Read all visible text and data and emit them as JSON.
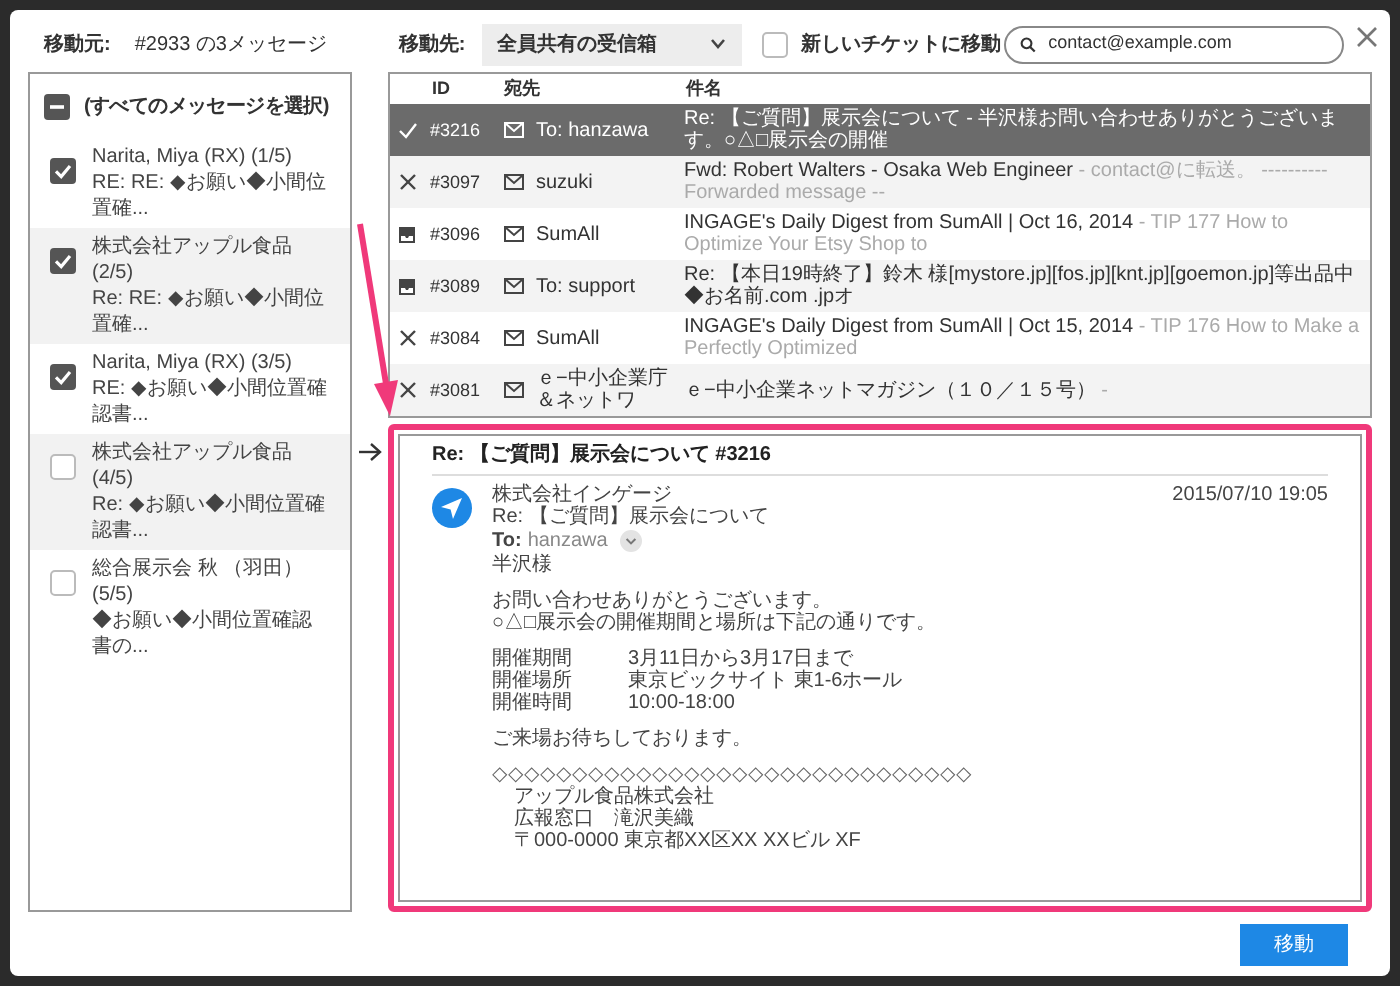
{
  "header": {
    "source_label": "移動元:",
    "source_value": "#2933 の3メッセージ",
    "destination_label": "移動先:",
    "destination_value": "全員共有の受信箱",
    "new_ticket": {
      "label": "新しいチケットに移動",
      "checked": false
    },
    "search": {
      "value": "contact@example.com"
    }
  },
  "messages": {
    "select_all": {
      "label": "(すべてのメッセージを選択)",
      "indeterminate": true
    },
    "items": [
      {
        "sender": "Narita, Miya (RX)  (1/5)",
        "subject": "RE: RE: ◆お願い◆小間位置確...",
        "checked": true
      },
      {
        "sender": "株式会社アップル食品  (2/5)",
        "subject": "Re: RE: ◆お願い◆小間位置確...",
        "checked": true
      },
      {
        "sender": "Narita, Miya (RX)  (3/5)",
        "subject": "RE: ◆お願い◆小間位置確認書...",
        "checked": true
      },
      {
        "sender": "株式会社アップル食品  (4/5)",
        "subject": "Re: ◆お願い◆小間位置確認書...",
        "checked": false
      },
      {
        "sender": "総合展示会 秋 （羽田）  (5/5)",
        "subject": "◆お願い◆小間位置確認書の...",
        "checked": false
      }
    ]
  },
  "tickets": {
    "columns": [
      "ID",
      "宛先",
      "件名"
    ],
    "rows": [
      {
        "kind": "check",
        "id": "#3216",
        "recipient": "To: hanzawa",
        "subject": "Re: 【ご質問】展示会について - 半沢様お問い合わせありがとうございます。○△□展示会の開催",
        "selected": true
      },
      {
        "kind": "cross",
        "id": "#3097",
        "recipient": "suzuki",
        "subject": "Fwd: Robert Walters - Osaka Web Engineer",
        "snippet": " - contact@に転送。 ---------- Forwarded message --",
        "selected": false
      },
      {
        "kind": "inbox",
        "id": "#3096",
        "recipient": "SumAll",
        "subject": "INGAGE's Daily Digest from SumAll | Oct 16, 2014",
        "snippet": " - TIP 177 How to Optimize Your Etsy Shop to",
        "selected": false
      },
      {
        "kind": "inbox",
        "id": "#3089",
        "recipient": "To: support",
        "subject": "Re: 【本日19時終了】鈴木 様[mystore.jp][fos.jp][knt.jp][goemon.jp]等出品中 ◆お名前.com .jpオ",
        "selected": false
      },
      {
        "kind": "cross",
        "id": "#3084",
        "recipient": "SumAll",
        "subject": "INGAGE's Daily Digest from SumAll | Oct 15, 2014",
        "snippet": " - TIP 176 How to Make a Perfectly Optimized",
        "selected": false
      },
      {
        "kind": "cross",
        "id": "#3081",
        "recipient": "ｅ−中小企業庁＆ネットワ",
        "subject": "ｅ−中小企業ネットマガジン（１０／１５号）",
        "snippet": " -",
        "selected": false
      }
    ]
  },
  "preview": {
    "title": "Re: 【ご質問】展示会について #3216",
    "from": "株式会社インゲージ",
    "subject": "Re: 【ご質問】展示会について",
    "to_label": "To:",
    "to": "hanzawa",
    "date": "2015/07/10 19:05",
    "blocks": [
      {
        "kind": "text",
        "lines": [
          "半沢様"
        ]
      },
      {
        "kind": "text",
        "lines": [
          "お問い合わせありがとうございます。",
          "○△□展示会の開催期間と場所は下記の通りです。"
        ]
      },
      {
        "kind": "table",
        "rows": [
          {
            "label": "開催期間",
            "value": "3月11日から3月17日まで"
          },
          {
            "label": "開催場所",
            "value": "東京ビックサイト 東1-6ホール"
          },
          {
            "label": "開催時間",
            "value": "10:00-18:00"
          }
        ]
      },
      {
        "kind": "text",
        "lines": [
          "ご来場お待ちしております。"
        ]
      },
      {
        "kind": "signature",
        "rule": "◇◇◇◇◇◇◇◇◇◇◇◇◇◇◇◇◇◇◇◇◇◇◇◇◇◇◇◇◇◇",
        "lines": [
          "アップル食品株式会社",
          "広報窓口　滝沢美織",
          "〒000-0000 東京都XX区XX XXビル XF"
        ]
      }
    ]
  },
  "footer": {
    "move_button": "移動"
  }
}
